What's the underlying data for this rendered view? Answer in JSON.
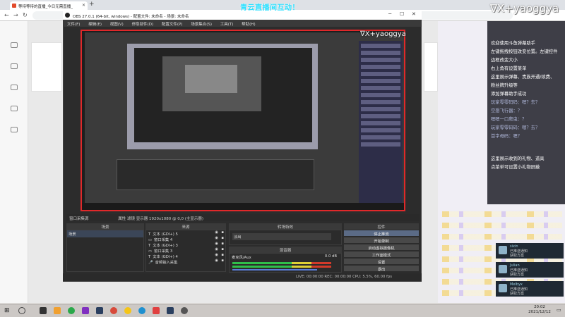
{
  "browser": {
    "tab_title": "等待等待的直播_今日无需直播_",
    "new_tab": "+"
  },
  "overlay": {
    "top_banner": "青云直播间互动！",
    "brand": "∇X+yaoggya",
    "right_lines": [
      {
        "text": "欢迎使用斗鱼弹幕助手",
        "dim": false
      },
      {
        "text": "左键拖拽按钮改变位置。左键控件",
        "dim": false
      },
      {
        "text": "边框改变大小",
        "dim": false
      },
      {
        "text": "右上角有设置菜单",
        "dim": false
      },
      {
        "text": "这里展示弹幕、贵族开通/续费、",
        "dim": false
      },
      {
        "text": "粉丝牌升级等",
        "dim": false
      },
      {
        "text": "添加弹幕助手成功",
        "dim": false
      },
      {
        "text": "玩家零零码码：嗯？去？",
        "dim": true
      },
      {
        "text": "空想飞行器：？",
        "dim": true
      },
      {
        "text": "嗯嗯一口爬虫：？",
        "dim": true
      },
      {
        "text": "玩家零零码码：嗯？去？",
        "dim": true
      },
      {
        "text": "首字母码：嗯？",
        "dim": true
      },
      {
        "text": "这里展示收到的礼物、道具",
        "dim": false
      },
      {
        "text": "点菜单可设置小礼物屏蔽",
        "dim": false
      }
    ]
  },
  "obs": {
    "title": "OBS 27.0.1 (64-bit, windows) - 配置文件: 未命名 - 场景: 未命名",
    "menu": [
      "文件(F)",
      "编辑(E)",
      "视图(V)",
      "停靠部件(D)",
      "配置文件(P)",
      "场景集合(S)",
      "工具(T)",
      "帮助(H)"
    ],
    "nested_brand": "∇X+yaoggya",
    "source_status": "窗口采集源",
    "property_bar": "属性   滤镜   显示器  1920x1080 @ 0,0 (主显示器)",
    "docks": {
      "scenes_title": "场景",
      "sources_title": "来源",
      "transitions_title": "转场特效",
      "mixer_title": "混音器",
      "controls_title": "控件"
    },
    "scenes": [
      "场景"
    ],
    "sources": [
      {
        "icon": "T",
        "name": "文本 (GDI+) 5"
      },
      {
        "icon": "▭",
        "name": "窗口采集 4"
      },
      {
        "icon": "T",
        "name": "文本 (GDI+) 3"
      },
      {
        "icon": "▭",
        "name": "窗口采集 3"
      },
      {
        "icon": "T",
        "name": "文本 (GDI+) 4"
      },
      {
        "icon": "🎤",
        "name": "音频输入采集"
      }
    ],
    "transition": "淡出",
    "mixer": [
      {
        "name": "麦克风/Aux",
        "db": "0.0 dB"
      }
    ],
    "controls": [
      "停止推流",
      "开始录制",
      "启动虚拟摄像机",
      "工作室模式",
      "设置",
      "退出"
    ],
    "statusbar": "LIVE: 00:00:00   REC: 00:00:00   CPU: 5.5%, 60.00 fps"
  },
  "notifications": [
    {
      "title": "sixin",
      "line1": "已推送通知",
      "line2": "获取方案"
    },
    {
      "title": "Julian",
      "line1": "已推送通知",
      "line2": "获取方案"
    },
    {
      "title": "Melbyx",
      "line1": "已推送通知",
      "line2": "获取方案"
    }
  ],
  "taskbar": {
    "time": "20:02",
    "date": "2021/12/12"
  },
  "colors": {
    "obs_bg": "#2c2c2c",
    "preview_border": "#e0282a",
    "banner": "#2de0ff",
    "taskbar": "#ccc8c5"
  }
}
